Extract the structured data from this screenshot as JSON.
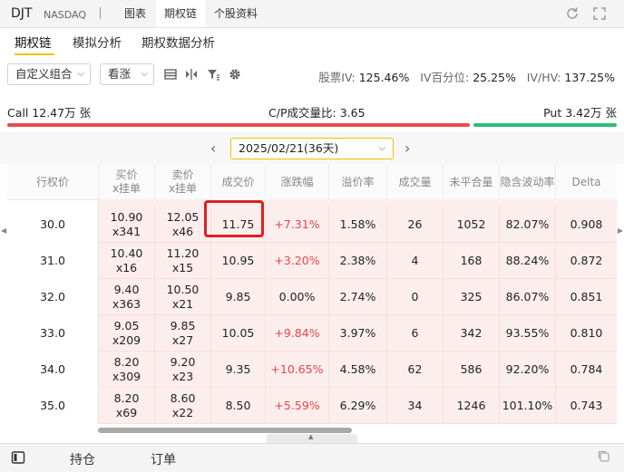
{
  "topbar": {
    "ticker": "DJT",
    "exchange": "NASDAQ",
    "tabs": [
      "图表",
      "期权链",
      "个股资料"
    ]
  },
  "subtabs": [
    "期权链",
    "模拟分析",
    "期权数据分析"
  ],
  "toolbar": {
    "combo": "自定义组合",
    "direction": "看涨",
    "stats": {
      "iv_label": "股票IV:",
      "iv": "125.46%",
      "pct_label": "IV百分位:",
      "pct": "25.25%",
      "ivhv_label": "IV/HV:",
      "ivhv": "137.25%"
    }
  },
  "callput": {
    "call": "Call 12.47万 张",
    "ratio_label": "C/P成交量比:",
    "ratio": "3.65",
    "put": "Put 3.42万 张",
    "call_fraction": 0.785
  },
  "expiry": {
    "selected": "2025/02/21(36天)"
  },
  "table": {
    "headers": [
      "行权价",
      "买价\nx挂单",
      "卖价\nx挂单",
      "成交价",
      "涨跌幅",
      "溢价率",
      "成交量",
      "未平合量",
      "隐含波动率",
      "Delta"
    ],
    "rows": [
      {
        "strike": "30.0",
        "bid": "10.90",
        "bid_size": "x341",
        "ask": "12.05",
        "ask_size": "x46",
        "last": "11.75",
        "change": "+7.31%",
        "premium": "1.58%",
        "volume": "26",
        "oi": "1052",
        "iv": "82.07%",
        "delta": "0.908"
      },
      {
        "strike": "31.0",
        "bid": "10.40",
        "bid_size": "x16",
        "ask": "11.20",
        "ask_size": "x15",
        "last": "10.95",
        "change": "+3.20%",
        "premium": "2.38%",
        "volume": "4",
        "oi": "168",
        "iv": "88.24%",
        "delta": "0.872"
      },
      {
        "strike": "32.0",
        "bid": "9.40",
        "bid_size": "x363",
        "ask": "10.50",
        "ask_size": "x21",
        "last": "9.85",
        "change": "0.00%",
        "premium": "2.74%",
        "volume": "0",
        "oi": "325",
        "iv": "86.07%",
        "delta": "0.851"
      },
      {
        "strike": "33.0",
        "bid": "9.05",
        "bid_size": "x209",
        "ask": "9.85",
        "ask_size": "x27",
        "last": "10.05",
        "change": "+9.84%",
        "premium": "3.97%",
        "volume": "6",
        "oi": "342",
        "iv": "93.55%",
        "delta": "0.810"
      },
      {
        "strike": "34.0",
        "bid": "8.20",
        "bid_size": "x309",
        "ask": "9.20",
        "ask_size": "x23",
        "last": "9.35",
        "change": "+10.65%",
        "premium": "4.58%",
        "volume": "62",
        "oi": "586",
        "iv": "92.20%",
        "delta": "0.784"
      },
      {
        "strike": "35.0",
        "bid": "8.20",
        "bid_size": "x69",
        "ask": "8.60",
        "ask_size": "x22",
        "last": "8.50",
        "change": "+5.59%",
        "premium": "6.29%",
        "volume": "34",
        "oi": "1246",
        "iv": "101.10%",
        "delta": "0.743"
      }
    ]
  },
  "footer": {
    "tabs": [
      "持仓",
      "订单"
    ]
  },
  "colors": {
    "up": "#e84545",
    "call_bar": "#ea4c4c",
    "put_bar": "#2cbd7a",
    "accent": "#f2c200",
    "highlight": "#e02020"
  }
}
